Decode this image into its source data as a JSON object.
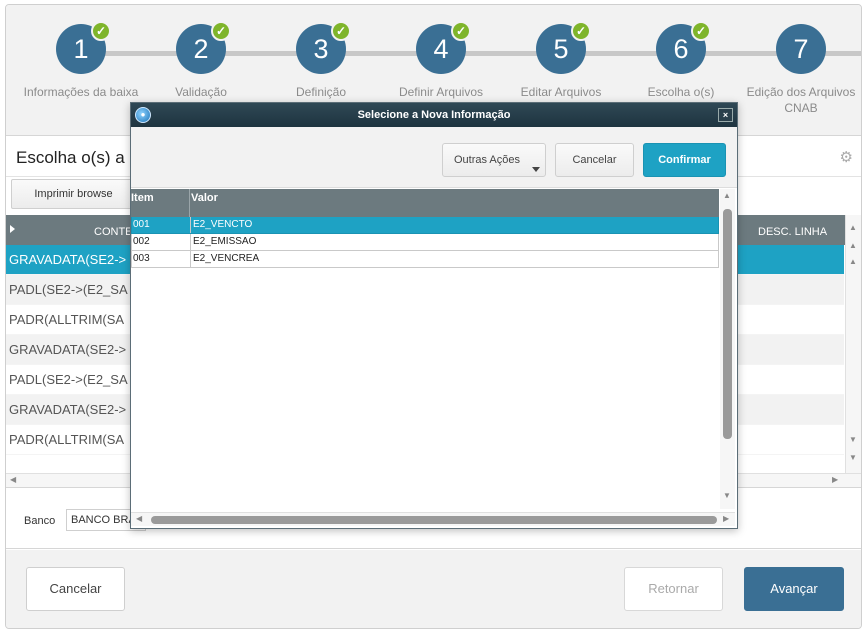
{
  "wizard": {
    "steps": [
      {
        "number": "1",
        "label": "Informações da baixa",
        "done": true
      },
      {
        "number": "2",
        "label": "Validação",
        "done": true
      },
      {
        "number": "3",
        "label": "Definição",
        "done": true
      },
      {
        "number": "4",
        "label": "Definir Arquivos",
        "done": true
      },
      {
        "number": "5",
        "label": "Editar Arquivos",
        "done": true
      },
      {
        "number": "6",
        "label": "Escolha o(s)",
        "done": true
      },
      {
        "number": "7",
        "label": "Edição dos Arquivos CNAB",
        "done": false
      }
    ],
    "check_glyph": "✓"
  },
  "header": {
    "title": "Escolha o(s) a",
    "gear_icon": "gear-icon"
  },
  "toolbar": {
    "print_label": "Imprimir browse"
  },
  "grid": {
    "columns": [
      "CONTEU",
      "DESC. LINHA"
    ],
    "rows": [
      "GRAVADATA(SE2->",
      "PADL(SE2->(E2_SA",
      "PADR(ALLTRIM(SA",
      "GRAVADATA(SE2->",
      "PADL(SE2->(E2_SA",
      "GRAVADATA(SE2->",
      "PADR(ALLTRIM(SA"
    ],
    "selected_index": 0
  },
  "banco": {
    "label": "Banco",
    "value": "BANCO BRA"
  },
  "footer": {
    "cancel": "Cancelar",
    "back": "Retornar",
    "next": "Avançar"
  },
  "dialog": {
    "title": "Selecione a Nova Informação",
    "close_glyph": "×",
    "more_actions": "Outras Ações",
    "cancel": "Cancelar",
    "confirm": "Confirmar",
    "columns": [
      "Item",
      "Valor"
    ],
    "rows": [
      {
        "item": "001",
        "valor": "E2_VENCTO"
      },
      {
        "item": "002",
        "valor": "E2_EMISSAO"
      },
      {
        "item": "003",
        "valor": "E2_VENCREA"
      }
    ],
    "selected_index": 0
  },
  "colors": {
    "primary": "#3a6f94",
    "accent": "#1ea2c4",
    "check": "#7fb52b",
    "grid_header": "#6c7a7f"
  }
}
